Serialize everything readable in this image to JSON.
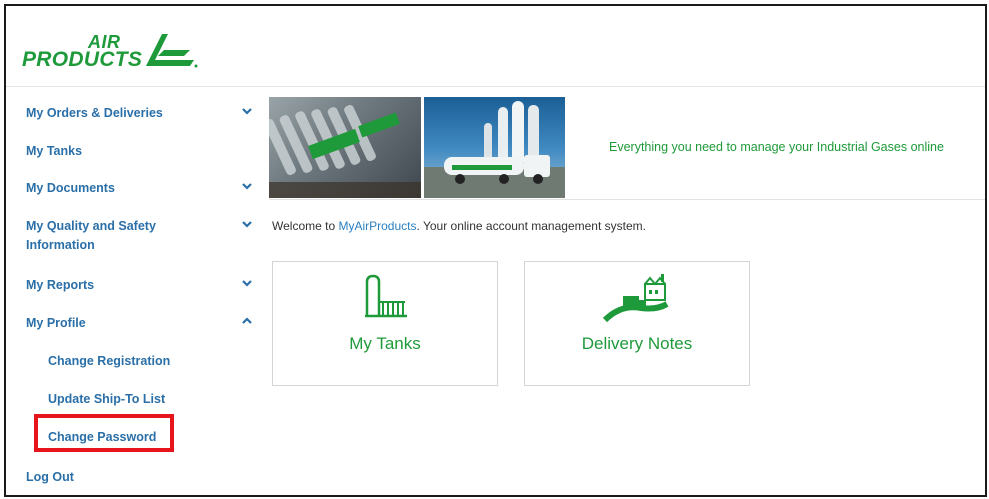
{
  "logo": {
    "top": "AIR",
    "bottom": "PRODUCTS"
  },
  "nav": {
    "items": [
      {
        "label": "My Orders & Deliveries",
        "chevron": "chevron-down-icon"
      },
      {
        "label": "My Tanks"
      },
      {
        "label": "My Documents",
        "chevron": "chevron-down-icon"
      },
      {
        "label": "My Quality and Safety Information",
        "chevron": "chevron-down-icon"
      },
      {
        "label": "My Reports",
        "chevron": "chevron-down-icon"
      },
      {
        "label": "My Profile",
        "chevron": "chevron-up-icon"
      }
    ],
    "profile_sub": [
      {
        "label": "Change Registration"
      },
      {
        "label": "Update Ship-To List"
      },
      {
        "label": "Change Password"
      }
    ],
    "logout": "Log Out"
  },
  "banner": {
    "tagline": "Everything you need to manage your Industrial Gases online"
  },
  "welcome": {
    "prefix": "Welcome to ",
    "brand": "MyAirProducts",
    "suffix": ". Your online account management system."
  },
  "tiles": [
    {
      "label": "My Tanks",
      "icon": "tank-icon"
    },
    {
      "label": "Delivery Notes",
      "icon": "delivery-truck-icon"
    }
  ],
  "colors": {
    "brand_green": "#1f9a3a",
    "link_blue": "#2a6fa8",
    "highlight_red": "#e8141b"
  }
}
